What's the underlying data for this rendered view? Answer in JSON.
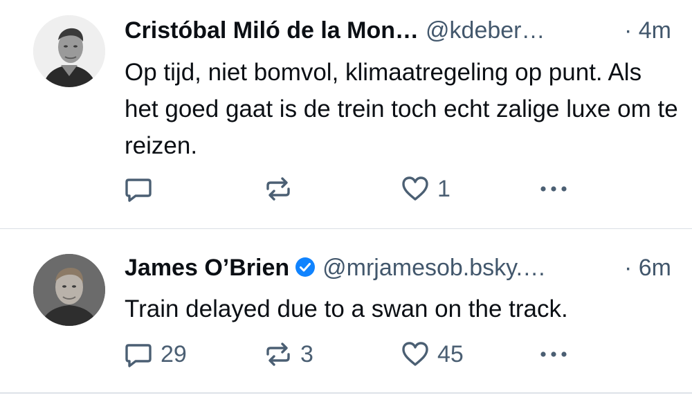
{
  "posts": [
    {
      "author_name": "Cristóbal Miló de la Mon…",
      "handle": "@kdeber…",
      "time": "· 4m",
      "verified": false,
      "text": "Op tijd, niet bomvol, klimaatregeling op punt. Als het goed gaat is de trein toch echt zalige luxe om te reizen.",
      "replies": "",
      "reposts": "",
      "likes": "1"
    },
    {
      "author_name": "James O’Brien",
      "handle": "@mrjamesob.bsky.…",
      "time": "· 6m",
      "verified": true,
      "text": "Train delayed due to a swan on the track.",
      "replies": "29",
      "reposts": "3",
      "likes": "45"
    }
  ],
  "colors": {
    "text_primary": "#0b0f14",
    "text_secondary": "#42576c",
    "verified_badge": "#1083fe",
    "divider": "#d9dee4"
  },
  "icons": [
    "reply-icon",
    "repost-icon",
    "like-icon",
    "more-icon",
    "verified-icon"
  ]
}
